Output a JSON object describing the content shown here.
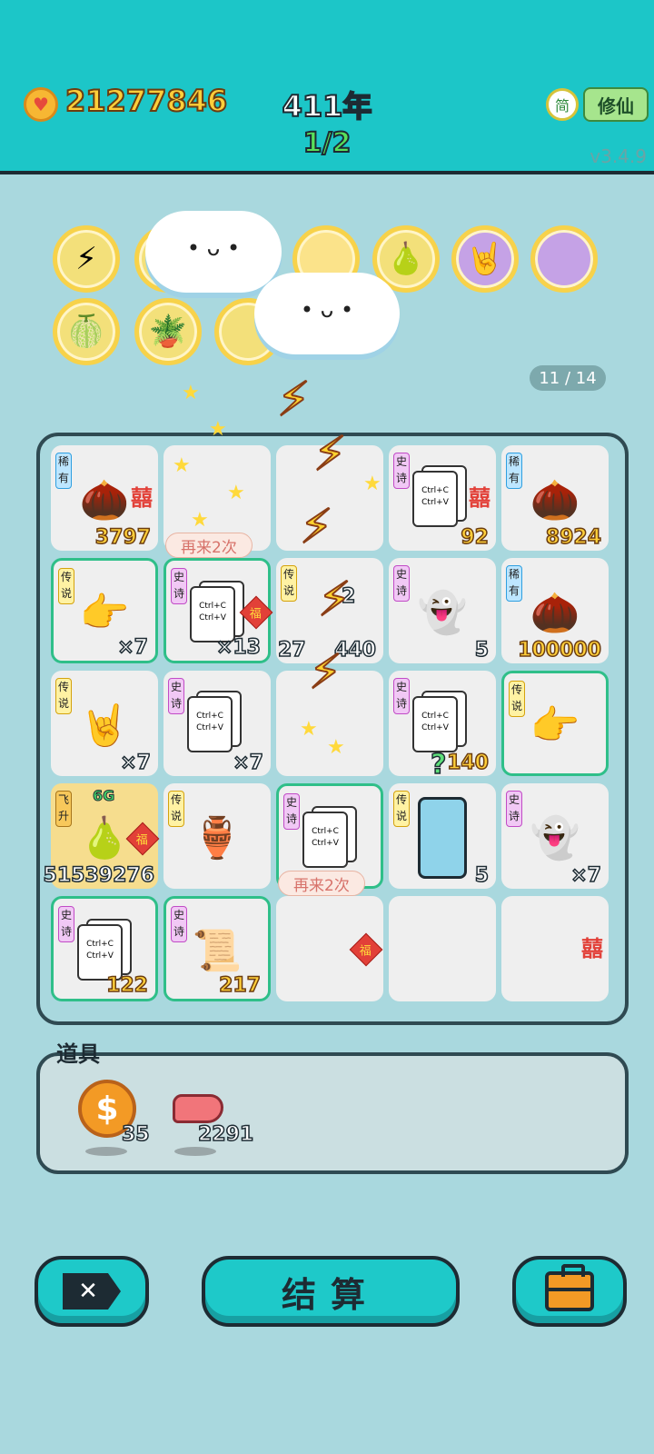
{
  "header": {
    "money": "21277846",
    "year": "411年",
    "round": "1/2",
    "simplified": "简",
    "mode_button": "修仙",
    "version": "v3.4.9"
  },
  "abilities": {
    "counter": "11 / 14"
  },
  "board": {
    "cells": [
      {
        "tag": "稀有",
        "value": "3797",
        "xi": "囍"
      },
      {
        "tag": "",
        "value": ""
      },
      {
        "tag": "",
        "value": ""
      },
      {
        "tag": "史诗",
        "value": "92",
        "xi": "囍",
        "card_line1": "Ctrl+C",
        "card_line2": "Ctrl+V"
      },
      {
        "tag": "稀有",
        "value": "8924"
      },
      {
        "tag": "传说",
        "value": "×7"
      },
      {
        "tag": "史诗",
        "value": "×13",
        "card_line1": "Ctrl+C",
        "card_line2": "Ctrl+V",
        "fu": "福"
      },
      {
        "tag": "传说",
        "value": "27",
        "value2": "440",
        "extra": "2"
      },
      {
        "tag": "史诗",
        "value": "5"
      },
      {
        "tag": "稀有",
        "value": "100000"
      },
      {
        "tag": "传说",
        "value": "×7"
      },
      {
        "tag": "史诗",
        "value": "×7",
        "card_line1": "Ctrl+C",
        "card_line2": "Ctrl+V"
      },
      {
        "tag": "",
        "value": ""
      },
      {
        "tag": "史诗",
        "value": "140",
        "card_line1": "Ctrl+C",
        "card_line2": "Ctrl+V"
      },
      {
        "tag": "传说",
        "value": ""
      },
      {
        "tag": "飞升",
        "value": "51539276",
        "top": "6G",
        "fu": "福"
      },
      {
        "tag": "传说",
        "value": ""
      },
      {
        "tag": "史诗",
        "value": "",
        "card_line1": "Ctrl+C",
        "card_line2": "Ctrl+V"
      },
      {
        "tag": "传说",
        "value": "5"
      },
      {
        "tag": "史诗",
        "value": "×7"
      },
      {
        "tag": "史诗",
        "value": "122",
        "card_line1": "Ctrl+C",
        "card_line2": "Ctrl+V"
      },
      {
        "tag": "史诗",
        "value": "217"
      },
      {
        "tag": "",
        "value": "",
        "fu": "福"
      },
      {
        "tag": "",
        "value": ""
      },
      {
        "tag": "",
        "value": "",
        "xi": "囍"
      }
    ],
    "bubble1": "再来2次",
    "bubble2": "再来2次",
    "question": "?"
  },
  "items": {
    "label": "道具",
    "coin_count": "35",
    "liver_count": "2291"
  },
  "buttons": {
    "settle": "结算"
  },
  "colors": {
    "teal": "#1cc6c8",
    "bg": "#a9d8de",
    "gold": "#ffcf3a"
  }
}
